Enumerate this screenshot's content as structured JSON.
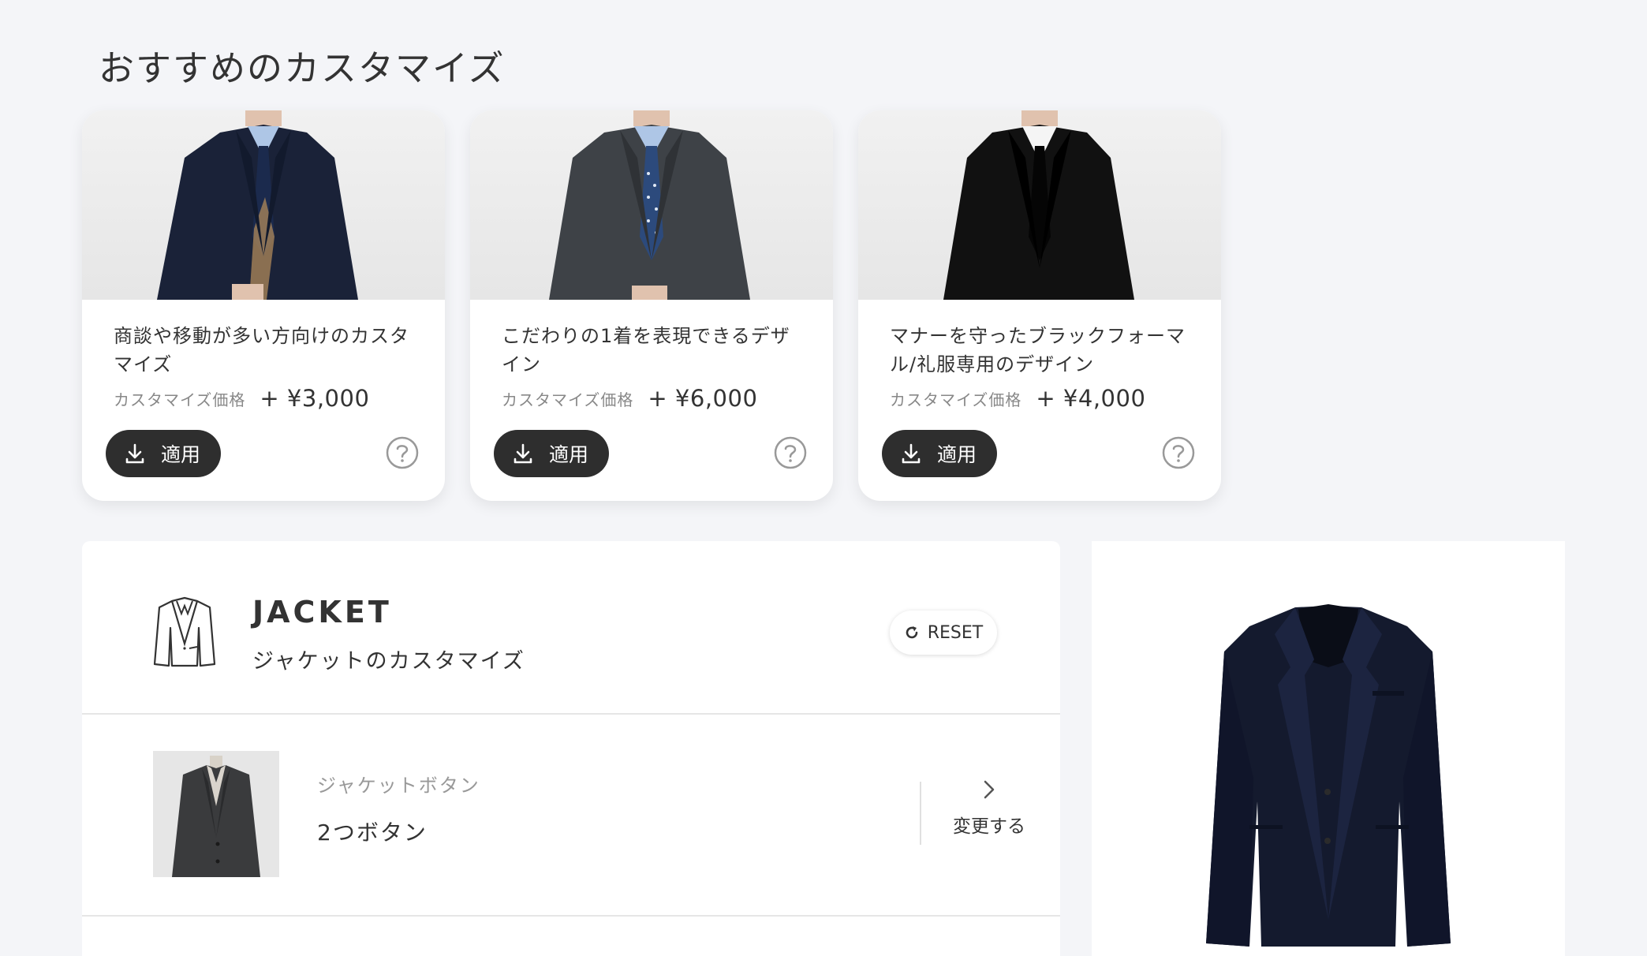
{
  "section": {
    "title": "おすすめのカスタマイズ"
  },
  "cards": [
    {
      "description": "商談や移動が多い方向けのカスタマイズ",
      "price_label": "カスタマイズ価格",
      "price": "+ ¥3,000",
      "apply_label": "適用",
      "image": "navy-suit-photo"
    },
    {
      "description": "こだわりの1着を表現できるデザイン",
      "price_label": "カスタマイズ価格",
      "price": "+ ¥6,000",
      "apply_label": "適用",
      "image": "gray-suit-photo"
    },
    {
      "description": "マナーを守ったブラックフォーマル/礼服専用のデザイン",
      "price_label": "カスタマイズ価格",
      "price": "+ ¥4,000",
      "apply_label": "適用",
      "image": "black-suit-photo"
    }
  ],
  "panel": {
    "title": "JACKET",
    "subtitle": "ジャケットのカスタマイズ",
    "reset_label": "RESET",
    "option": {
      "label": "ジャケットボタン",
      "value": "2つボタン",
      "change_label": "変更する"
    }
  },
  "colors": {
    "dark_button": "#2e2e2e",
    "background": "#f4f5f8",
    "accent_text": "#333333"
  }
}
